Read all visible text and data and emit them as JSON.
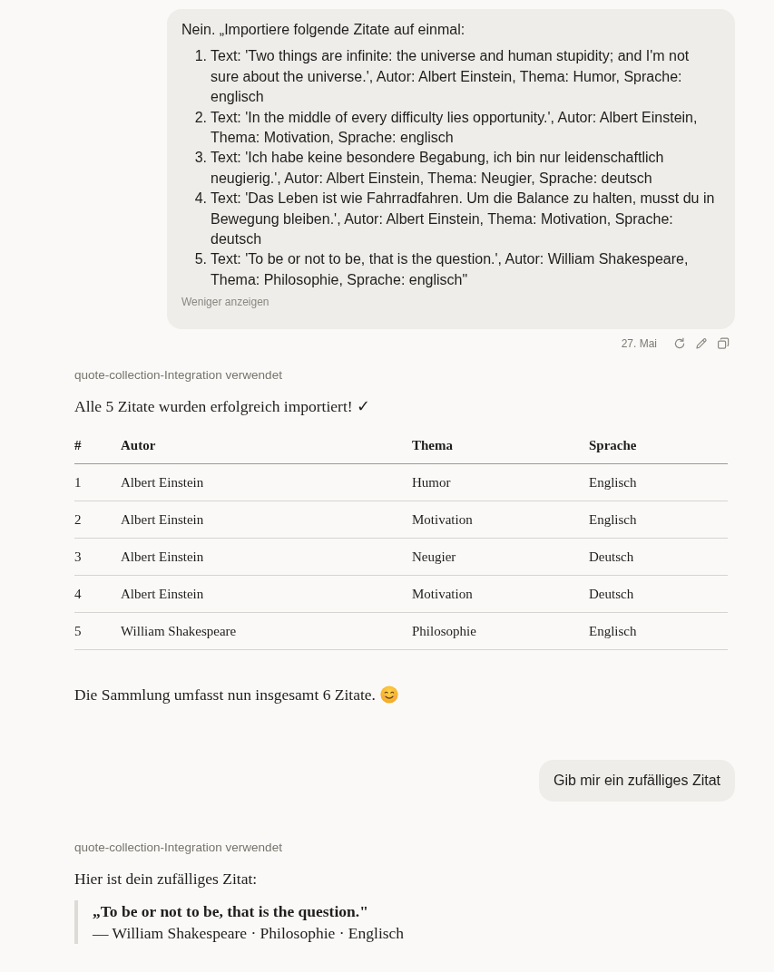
{
  "messages": [
    {
      "kind": "user",
      "text": "Nein. „Importiere folgende Zitate auf einmal:",
      "items": [
        {
          "number": "1.",
          "text": "Text: 'Two things are infinite: the universe and human stupidity; and I'm not sure about the universe.', Autor: Albert Einstein, Thema: Humor, Sprache: englisch"
        },
        {
          "number": "2.",
          "text": "Text: 'In the middle of every difficulty lies opportunity.', Autor: Albert Einstein, Thema: Motivation, Sprache: englisch"
        },
        {
          "number": "3.",
          "text": "Text: 'Ich habe keine besondere Begabung, ich bin nur leidenschaftlich neugierig.', Autor: Albert Einstein, Thema: Neugier, Sprache: deutsch"
        },
        {
          "number": "4.",
          "text": "Text: 'Das Leben ist wie Fahrradfahren. Um die Balance zu halten, musst du in Bewegung bleiben.', Autor: Albert Einstein, Thema: Motivation, Sprache: deutsch"
        },
        {
          "number": "5.",
          "text": "Text: 'To be or not to be, that is the question.', Autor: William Shakespeare, Thema: Philosophie, Sprache: englisch\""
        }
      ],
      "toggle": "Weniger anzeigen",
      "date": "27. Mai"
    },
    {
      "kind": "assistant",
      "tool_note": "quote-collection-Integration verwendet",
      "blocks": [
        {
          "kind": "paragraph",
          "text": "Alle 5 Zitate wurden erfolgreich importiert! ✓",
          "trailing_emoji": false
        },
        {
          "kind": "table",
          "columns": [
            "#",
            "Autor",
            "Thema",
            "Sprache"
          ],
          "rows": [
            [
              "1",
              "Albert Einstein",
              "Humor",
              "Englisch"
            ],
            [
              "2",
              "Albert Einstein",
              "Motivation",
              "Englisch"
            ],
            [
              "3",
              "Albert Einstein",
              "Neugier",
              "Deutsch"
            ],
            [
              "4",
              "Albert Einstein",
              "Motivation",
              "Deutsch"
            ],
            [
              "5",
              "William Shakespeare",
              "Philosophie",
              "Englisch"
            ]
          ]
        },
        {
          "kind": "paragraph",
          "text": "Die Sammlung umfasst nun insgesamt 6 Zitate.",
          "trailing_emoji": true
        }
      ]
    },
    {
      "kind": "user",
      "text": "Gib mir ein zufälliges Zitat"
    },
    {
      "kind": "assistant",
      "tool_note": "quote-collection-Integration verwendet",
      "blocks": [
        {
          "kind": "paragraph",
          "text": "Hier ist dein zufälliges Zitat:",
          "trailing_emoji": false
        },
        {
          "kind": "quote",
          "text": "„To be or not to be, that is the question.\"",
          "attribution": "— William Shakespeare · Philosophie · Englisch"
        }
      ]
    }
  ]
}
